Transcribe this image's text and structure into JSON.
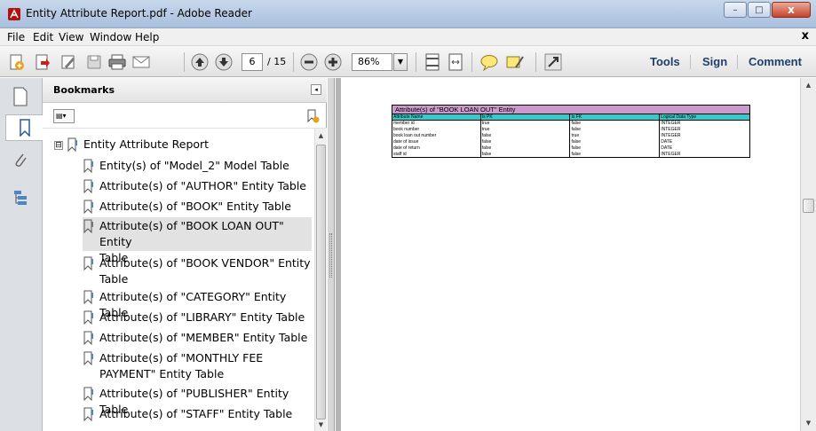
{
  "window": {
    "title": "Entity Attribute Report.pdf - Adobe Reader",
    "controls": {
      "minimize": "–",
      "maximize": "□",
      "close": "x"
    }
  },
  "menu": {
    "items": [
      "File",
      "Edit",
      "View",
      "Window",
      "Help"
    ],
    "close": "x"
  },
  "toolbar": {
    "page_current": "6",
    "page_total": "/ 15",
    "zoom": "86%",
    "zoom_arrow": "▼",
    "tools": "Tools",
    "sign": "Sign",
    "comment": "Comment"
  },
  "bookmarks": {
    "header": "Bookmarks",
    "collapse": "◂",
    "options": "▤▾",
    "expander": "⊟",
    "items": [
      {
        "label": "Entity Attribute Report"
      },
      {
        "label": "Entity(s) of \"Model_2\" Model Table"
      },
      {
        "label": "Attribute(s) of \"AUTHOR\" Entity Table"
      },
      {
        "label": "Attribute(s) of \"BOOK\" Entity Table"
      },
      {
        "line1": "Attribute(s) of \"BOOK LOAN OUT\" Entity",
        "line2": "Table"
      },
      {
        "line1": "Attribute(s) of \"BOOK VENDOR\" Entity",
        "line2": "Table"
      },
      {
        "label": "Attribute(s) of \"CATEGORY\" Entity Table"
      },
      {
        "label": "Attribute(s) of \"LIBRARY\" Entity Table"
      },
      {
        "label": "Attribute(s) of \"MEMBER\" Entity Table"
      },
      {
        "line1": "Attribute(s) of \"MONTHLY FEE",
        "line2": "PAYMENT\" Entity Table"
      },
      {
        "label": "Attribute(s) of \"PUBLISHER\" Entity Table"
      },
      {
        "label": "Attribute(s) of \"STAFF\" Entity Table"
      }
    ]
  },
  "document": {
    "table": {
      "caption": "Attribute(s) of \"BOOK LOAN OUT\" Entity",
      "headers": [
        "Attribute Name",
        "Is PK",
        "Is FK",
        "Logical Data Type"
      ],
      "rows": [
        [
          "member id",
          "true",
          "false",
          "INTEGER"
        ],
        [
          "book number",
          "true",
          "false",
          "INTEGER"
        ],
        [
          "book loan out number",
          "false",
          "true",
          "INTEGER"
        ],
        [
          "date of issue",
          "false",
          "false",
          "DATE"
        ],
        [
          "date of return",
          "false",
          "false",
          "DATE"
        ],
        [
          "staff id",
          "false",
          "false",
          "INTEGER"
        ]
      ]
    }
  },
  "scroll": {
    "up": "▲",
    "down": "▼"
  },
  "colors": {
    "caption_bg": "#cc99cc",
    "header_bg": "#33cccc",
    "accent_text": "#1f3f6b"
  }
}
